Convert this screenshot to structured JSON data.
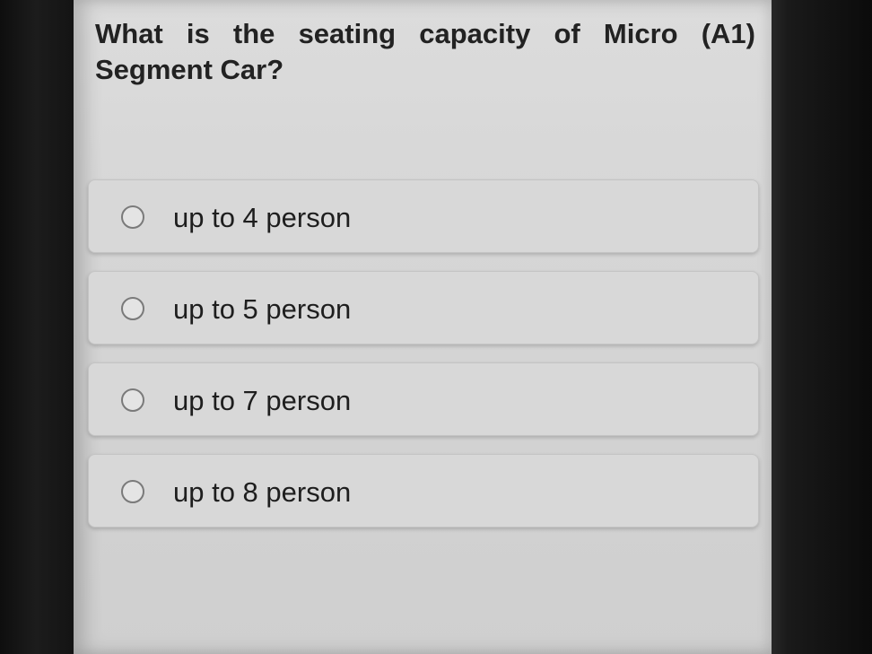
{
  "question": {
    "text": "What is the seating capacity of Micro (A1) Segment Car?"
  },
  "options": [
    {
      "label": "up to 4 person",
      "selected": false
    },
    {
      "label": "up to 5 person",
      "selected": false
    },
    {
      "label": "up to 7 person",
      "selected": false
    },
    {
      "label": "up to 8 person",
      "selected": false
    }
  ]
}
